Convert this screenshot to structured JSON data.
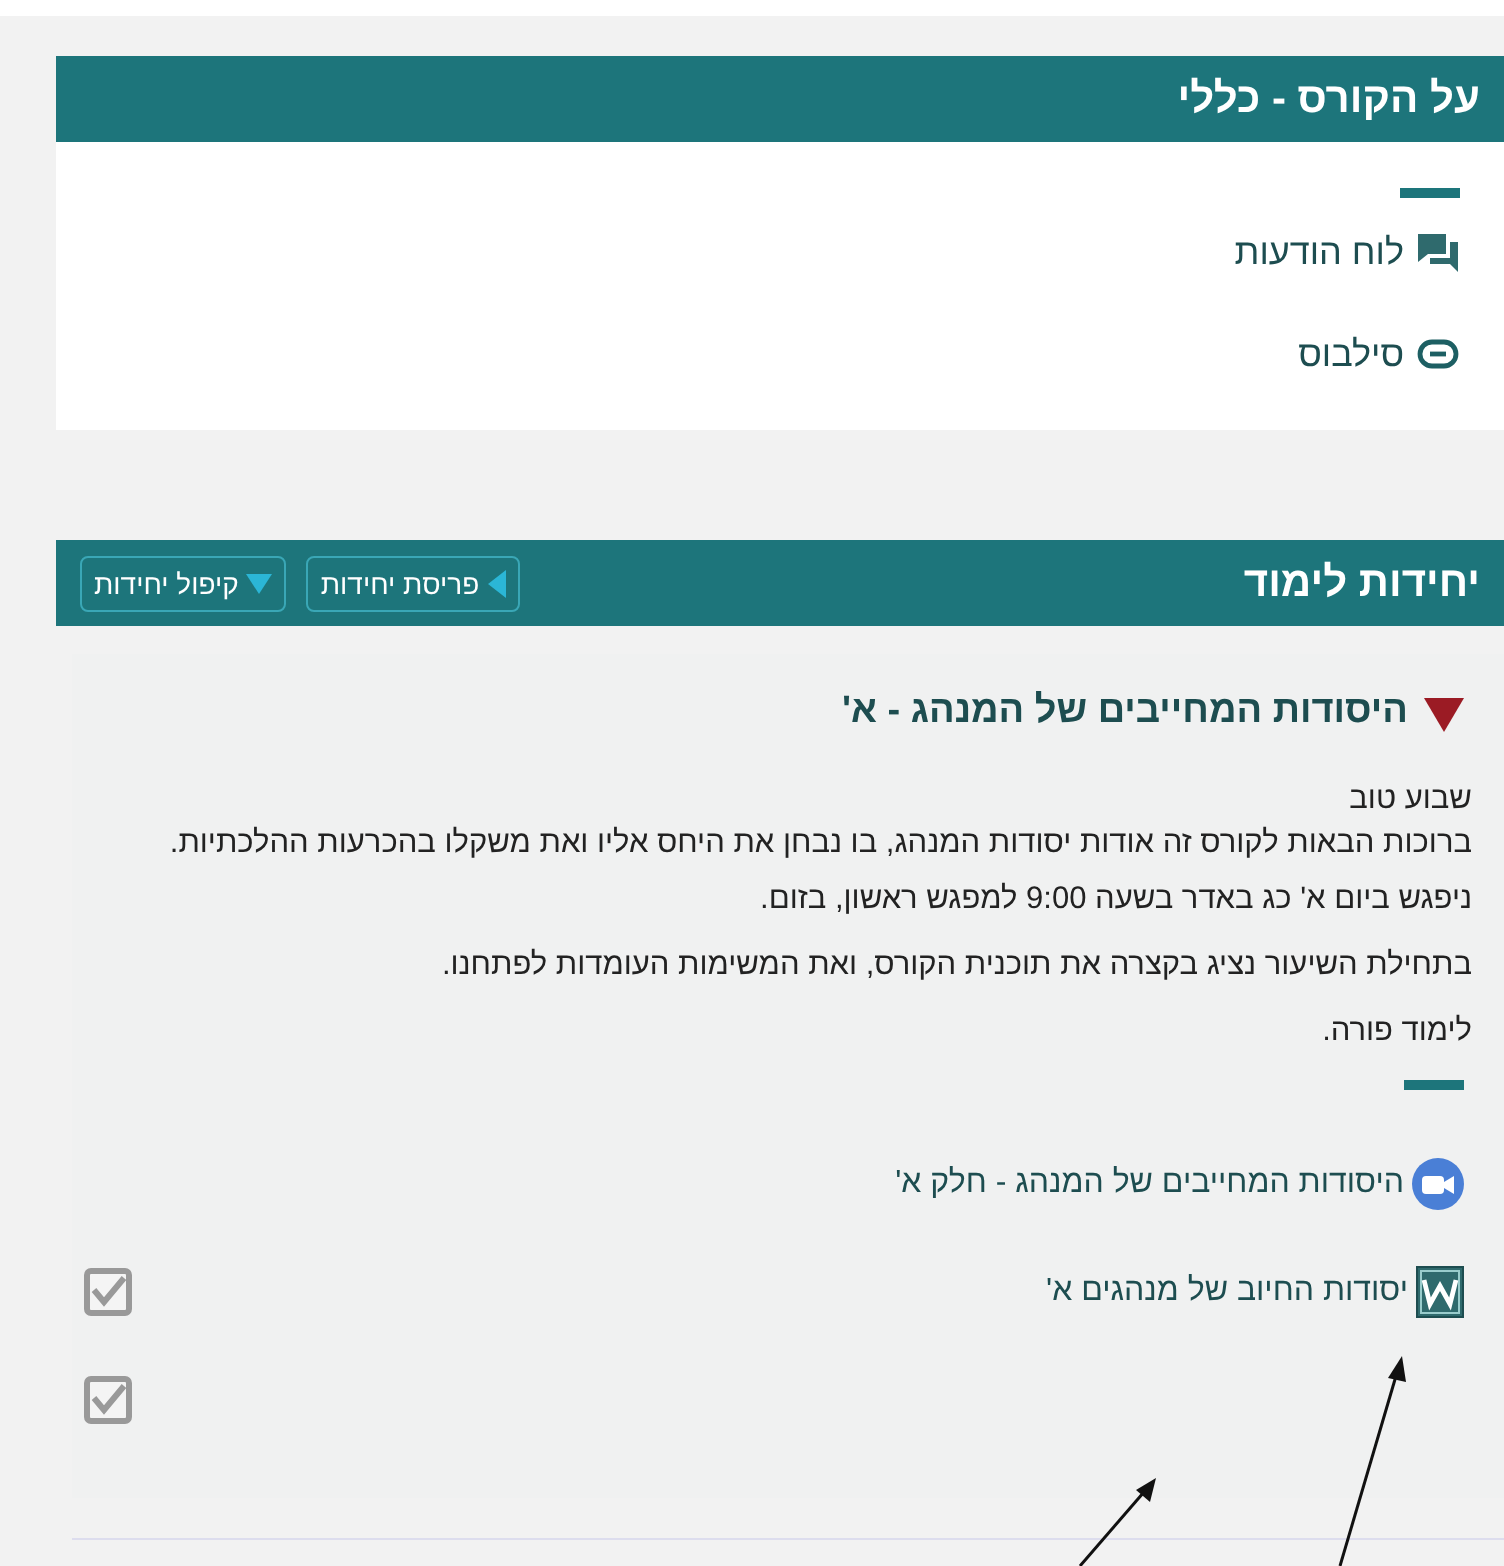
{
  "general_section": {
    "title": "על הקורס - כללי",
    "items": [
      {
        "kind": "forum",
        "label": "לוח הודעות"
      },
      {
        "kind": "link",
        "label": "סילבוס"
      }
    ]
  },
  "units_section": {
    "title": "יחידות לימוד",
    "buttons": [
      {
        "kind": "expand",
        "label": "פריסת יחידות"
      },
      {
        "kind": "collapse",
        "label": "קיפול יחידות"
      }
    ]
  },
  "unit": {
    "title": "היסודות המחייבים של המנהג - א'",
    "expanded": true,
    "paragraphs": [
      "שבוע טוב",
      "ברוכות הבאות לקורס זה אודות  יסודות המנהג, בו נבחן את היחס אליו ואת משקלו בהכרעות ההלכתיות.",
      "ניפגש ביום א' כג באדר בשעה 9:00 למפגש ראשון, בזום.",
      "בתחילת השיעור נציג בקצרה את תוכנית הקורס, ואת המשימות העומדות לפתחנו.",
      "לימוד פורה."
    ],
    "activities": [
      {
        "kind": "zoom",
        "title": "היסודות המחייבים של המנהג - חלק א'"
      },
      {
        "kind": "word",
        "title": "יסודות החיוב של מנהגים א'",
        "checked": true
      },
      {
        "kind": "blank",
        "checked": true
      }
    ]
  }
}
